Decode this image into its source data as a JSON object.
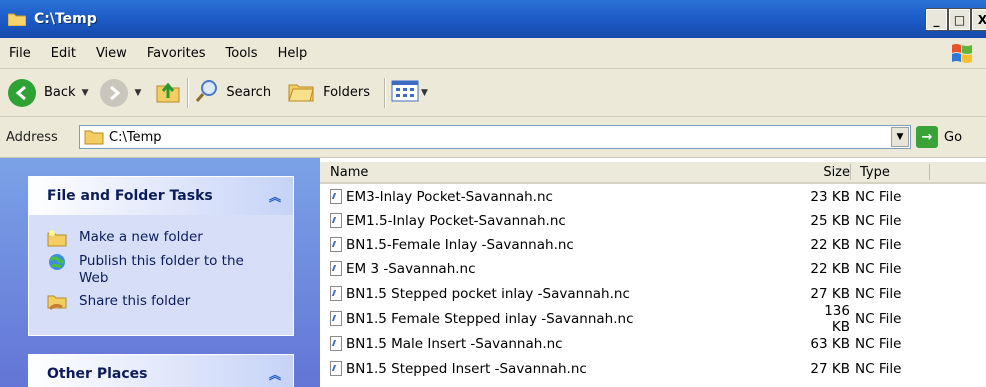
{
  "window": {
    "title": "C:\\Temp"
  },
  "title_buttons": [
    "_",
    "□",
    "X"
  ],
  "menu": [
    "File",
    "Edit",
    "View",
    "Favorites",
    "Tools",
    "Help"
  ],
  "toolbar": {
    "back_label": "Back",
    "search_label": "Search",
    "folders_label": "Folders"
  },
  "address": {
    "label": "Address",
    "value": "C:\\Temp",
    "go_label": "Go"
  },
  "tasks_panel": {
    "title": "File and Folder Tasks",
    "items": [
      "Make a new folder",
      "Publish this folder to the Web",
      "Share this folder"
    ]
  },
  "other_places": {
    "title": "Other Places"
  },
  "columns": {
    "name": "Name",
    "size": "Size",
    "type": "Type"
  },
  "files": [
    {
      "name": "EM3-Inlay Pocket-Savannah.nc",
      "size": "23 KB",
      "type": "NC File"
    },
    {
      "name": "EM1.5-Inlay Pocket-Savannah.nc",
      "size": "25 KB",
      "type": "NC File"
    },
    {
      "name": "BN1.5-Female Inlay -Savannah.nc",
      "size": "22 KB",
      "type": "NC File"
    },
    {
      "name": "EM 3 -Savannah.nc",
      "size": "22 KB",
      "type": "NC File"
    },
    {
      "name": "BN1.5 Stepped pocket inlay -Savannah.nc",
      "size": "27 KB",
      "type": "NC File"
    },
    {
      "name": "BN1.5 Female Stepped inlay -Savannah.nc",
      "size": "136 KB",
      "type": "NC File"
    },
    {
      "name": "BN1.5 Male Insert -Savannah.nc",
      "size": "63 KB",
      "type": "NC File"
    },
    {
      "name": "BN1.5 Stepped Insert -Savannah.nc",
      "size": "27 KB",
      "type": "NC File"
    }
  ],
  "colors": {
    "titlebar": "#1f5fcb",
    "panel_bg": "#7ba2e7",
    "chrome": "#ece9d8"
  }
}
